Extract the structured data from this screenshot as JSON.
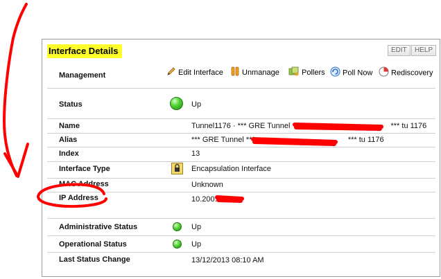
{
  "panel": {
    "title": "Interface Details",
    "edit_label": "EDIT",
    "help_label": "HELP"
  },
  "management": {
    "label": "Management",
    "actions": [
      {
        "label": "Edit Interface",
        "icon": "pencil-icon"
      },
      {
        "label": "Unmanage",
        "icon": "pause-icon"
      },
      {
        "label": "Pollers",
        "icon": "pollers-icon"
      },
      {
        "label": "Poll Now",
        "icon": "refresh-icon"
      },
      {
        "label": "Rediscovery",
        "icon": "rediscovery-icon"
      }
    ]
  },
  "status": {
    "label": "Status",
    "value": "Up",
    "indicator_color": "#3fbf2a"
  },
  "details": {
    "name": {
      "label": "Name",
      "value": "Tunnel1176 · *** GRE Tunnel ***",
      "suffix": "*** tu 1176"
    },
    "alias": {
      "label": "Alias",
      "value": "*** GRE Tunnel ***",
      "suffix": "*** tu 1176"
    },
    "index": {
      "label": "Index",
      "value": "13"
    },
    "interface_type": {
      "label": "Interface Type",
      "value": "Encapsulation Interface"
    },
    "mac": {
      "label": "MAC Address",
      "value": "Unknown"
    },
    "ip": {
      "label": "IP Address",
      "value": "10.200.1"
    }
  },
  "states": {
    "admin": {
      "label": "Administrative Status",
      "value": "Up"
    },
    "oper": {
      "label": "Operational Status",
      "value": "Up"
    },
    "last_change": {
      "label": "Last Status Change",
      "value": "13/12/2013 08:10 AM"
    }
  },
  "annotation_color": "#ff0000"
}
